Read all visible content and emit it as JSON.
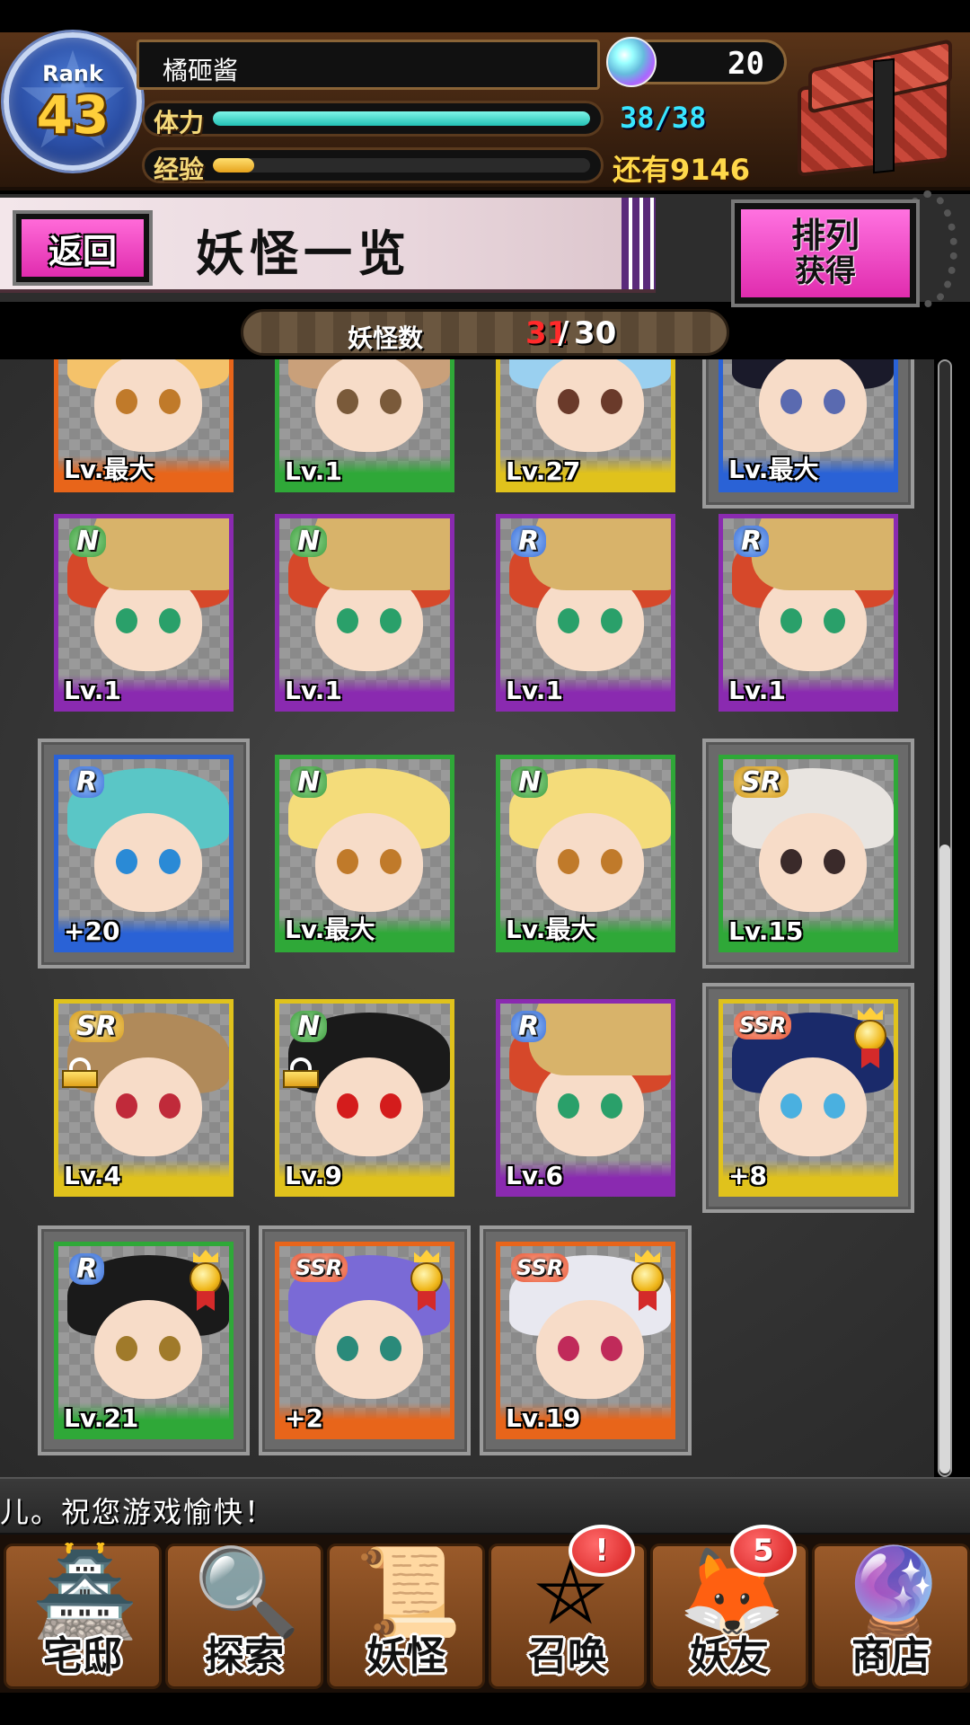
{
  "header": {
    "rank_label": "Rank",
    "rank_value": "43",
    "player_name": "橘砸酱",
    "gems": "20",
    "stamina_label": "体力",
    "stamina_value": "38/38",
    "stamina_fraction": 1.0,
    "exp_label": "经验",
    "exp_remaining": "还有9146",
    "exp_fraction": 0.11,
    "chest_icon": "treasure-chest-icon"
  },
  "title_bar": {
    "back_label": "返回",
    "page_title": "妖怪一览",
    "sort_line1": "排列",
    "sort_line2": "获得"
  },
  "count": {
    "label": "妖怪数",
    "current": "31",
    "separator": "/",
    "max": "30"
  },
  "cards": [
    {
      "rarity": "",
      "level": "Lv.最大",
      "color": "#e8651a",
      "hair": "#f4c26a",
      "eye": "#c07a2a",
      "framed": false,
      "lock": false,
      "medal": false
    },
    {
      "rarity": "",
      "level": "Lv.1",
      "color": "#2fa838",
      "hair": "#c9a07a",
      "eye": "#7a5a3a",
      "framed": false,
      "lock": false,
      "medal": false
    },
    {
      "rarity": "",
      "level": "Lv.27",
      "color": "#e0c21c",
      "hair": "#9ad0f0",
      "eye": "#6a3a2a",
      "framed": false,
      "lock": false,
      "medal": false
    },
    {
      "rarity": "",
      "level": "Lv.最大",
      "color": "#2a62d6",
      "hair": "#1a1a2a",
      "eye": "#5a6ab0",
      "framed": true,
      "lock": false,
      "medal": false
    },
    {
      "rarity": "N",
      "level": "Lv.1",
      "color": "#8a2ab0",
      "hair": "#d6482a",
      "eye": "#2aa06a",
      "framed": false,
      "lock": false,
      "medal": false,
      "hat": true
    },
    {
      "rarity": "N",
      "level": "Lv.1",
      "color": "#8a2ab0",
      "hair": "#d6482a",
      "eye": "#2aa06a",
      "framed": false,
      "lock": false,
      "medal": false,
      "hat": true
    },
    {
      "rarity": "R",
      "level": "Lv.1",
      "color": "#8a2ab0",
      "hair": "#d6482a",
      "eye": "#2aa06a",
      "framed": false,
      "lock": false,
      "medal": false,
      "hat": true
    },
    {
      "rarity": "R",
      "level": "Lv.1",
      "color": "#8a2ab0",
      "hair": "#d6482a",
      "eye": "#2aa06a",
      "framed": false,
      "lock": false,
      "medal": false,
      "hat": true
    },
    {
      "rarity": "R",
      "level": "+20",
      "color": "#2a62d6",
      "hair": "#5ac6c6",
      "eye": "#2a8ad6",
      "framed": true,
      "lock": false,
      "medal": false
    },
    {
      "rarity": "N",
      "level": "Lv.最大",
      "color": "#2fa838",
      "hair": "#f4dc7a",
      "eye": "#c07a2a",
      "framed": false,
      "lock": false,
      "medal": false
    },
    {
      "rarity": "N",
      "level": "Lv.最大",
      "color": "#2fa838",
      "hair": "#f4dc7a",
      "eye": "#c07a2a",
      "framed": false,
      "lock": false,
      "medal": false
    },
    {
      "rarity": "SR",
      "level": "Lv.15",
      "color": "#2fa838",
      "hair": "#e8e4e0",
      "eye": "#3a2a2a",
      "framed": true,
      "lock": false,
      "medal": false
    },
    {
      "rarity": "SR",
      "level": "Lv.4",
      "color": "#e0c21c",
      "hair": "#b08a5a",
      "eye": "#c02a3a",
      "framed": false,
      "lock": true,
      "medal": false
    },
    {
      "rarity": "N",
      "level": "Lv.9",
      "color": "#e0c21c",
      "hair": "#1a1a1a",
      "eye": "#d41c1c",
      "framed": false,
      "lock": true,
      "medal": false
    },
    {
      "rarity": "R",
      "level": "Lv.6",
      "color": "#8a2ab0",
      "hair": "#d6482a",
      "eye": "#2aa06a",
      "framed": false,
      "lock": false,
      "medal": false,
      "hat": true
    },
    {
      "rarity": "SSR",
      "level": "+8",
      "color": "#e0c21c",
      "hair": "#1a2a6a",
      "eye": "#4ab0e0",
      "framed": true,
      "lock": false,
      "medal": true
    },
    {
      "rarity": "R",
      "level": "Lv.21",
      "color": "#2fa838",
      "hair": "#1a1a1a",
      "eye": "#a07a2a",
      "framed": true,
      "lock": false,
      "medal": true
    },
    {
      "rarity": "SSR",
      "level": "+2",
      "color": "#e8651a",
      "hair": "#7a6ad6",
      "eye": "#2a8a7a",
      "framed": true,
      "lock": false,
      "medal": true
    },
    {
      "rarity": "SSR",
      "level": "Lv.19",
      "color": "#e8651a",
      "hair": "#e8e8f0",
      "eye": "#c02a5a",
      "framed": true,
      "lock": false,
      "medal": true
    }
  ],
  "ticker": "儿。祝您游戏愉快！",
  "nav": [
    {
      "label": "宅邸",
      "icon": "mansion-icon",
      "glyph": "🏯",
      "badge": ""
    },
    {
      "label": "探索",
      "icon": "magnifier-map-icon",
      "glyph": "🔍",
      "badge": ""
    },
    {
      "label": "妖怪",
      "icon": "scroll-icon",
      "glyph": "📜",
      "badge": ""
    },
    {
      "label": "召唤",
      "icon": "pentagram-icon",
      "glyph": "⛤",
      "badge": "!"
    },
    {
      "label": "妖友",
      "icon": "fox-girl-icon",
      "glyph": "🦊",
      "badge": "5"
    },
    {
      "label": "商店",
      "icon": "crystal-orb-icon",
      "glyph": "🔮",
      "badge": ""
    }
  ]
}
